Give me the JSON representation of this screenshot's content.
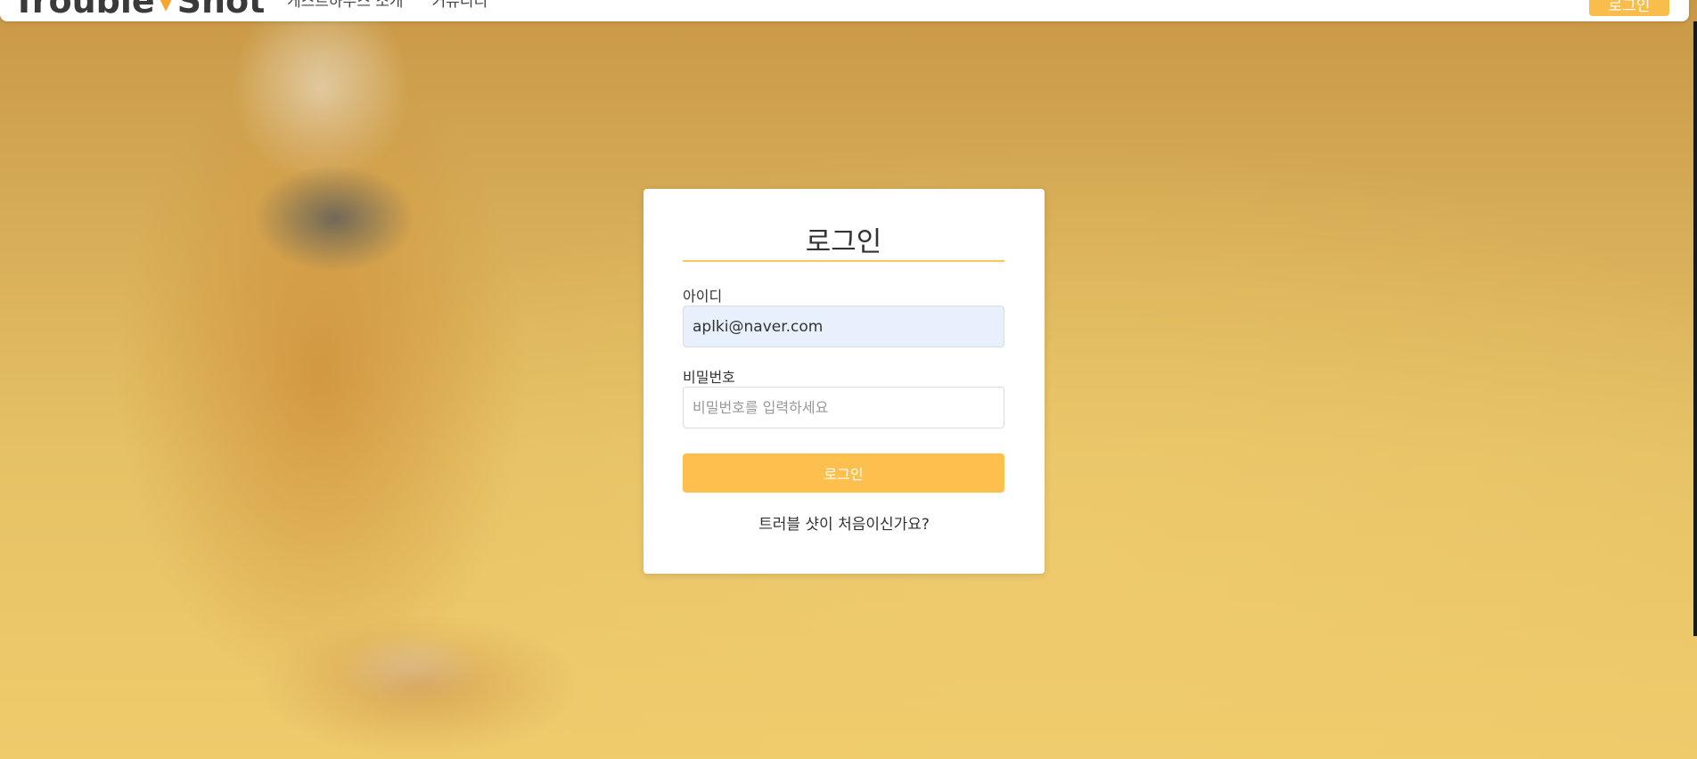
{
  "header": {
    "logo_text_1": "Trouble",
    "logo_text_2": "Shot",
    "nav_links": [
      {
        "label": "게스트하우스 소개"
      },
      {
        "label": "커뮤니티"
      }
    ],
    "login_button": "로그인"
  },
  "login_form": {
    "title": "로그인",
    "id_label": "아이디",
    "id_value": "aplki@naver.com",
    "password_label": "비밀번호",
    "password_placeholder": "비밀번호를 입력하세요",
    "submit_label": "로그인",
    "signup_link": "트러블 샷이 처음이신가요?"
  },
  "colors": {
    "accent": "#fdbf4d",
    "underline": "#f9c659",
    "autofill": "#e8f0fe"
  }
}
